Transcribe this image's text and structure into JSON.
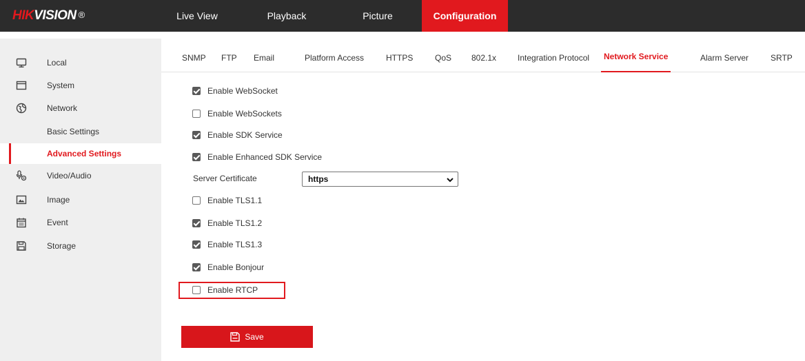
{
  "brand": {
    "logo_red": "HIK",
    "logo_white": "VISION",
    "reg_mark": "®"
  },
  "top_nav": [
    {
      "label": "Live View"
    },
    {
      "label": "Playback"
    },
    {
      "label": "Picture"
    },
    {
      "label": "Configuration",
      "active": true
    }
  ],
  "sidebar": {
    "items": [
      {
        "label": "Local",
        "icon": "monitor-icon"
      },
      {
        "label": "System",
        "icon": "window-icon"
      },
      {
        "label": "Network",
        "icon": "globe-icon"
      },
      {
        "label": "Basic Settings",
        "sub": true
      },
      {
        "label": "Advanced Settings",
        "sub": true,
        "active": true
      },
      {
        "label": "Video/Audio",
        "icon": "video-audio-icon"
      },
      {
        "label": "Image",
        "icon": "image-icon"
      },
      {
        "label": "Event",
        "icon": "calendar-icon"
      },
      {
        "label": "Storage",
        "icon": "floppy-icon"
      }
    ]
  },
  "tabs": [
    {
      "label": "SNMP"
    },
    {
      "label": "FTP"
    },
    {
      "label": "Email"
    },
    {
      "label": "Platform Access"
    },
    {
      "label": "HTTPS"
    },
    {
      "label": "QoS"
    },
    {
      "label": "802.1x"
    },
    {
      "label": "Integration Protocol"
    },
    {
      "label": "Network Service",
      "active": true
    },
    {
      "label": "Alarm Server"
    },
    {
      "label": "SRTP"
    }
  ],
  "options": [
    {
      "label": "Enable WebSocket",
      "checked": true
    },
    {
      "label": "Enable WebSockets",
      "checked": false
    },
    {
      "label": "Enable SDK Service",
      "checked": true
    },
    {
      "label": "Enable Enhanced SDK Service",
      "checked": true
    },
    {
      "label": "Enable TLS1.1",
      "checked": false
    },
    {
      "label": "Enable TLS1.2",
      "checked": true
    },
    {
      "label": "Enable TLS1.3",
      "checked": true
    },
    {
      "label": "Enable Bonjour",
      "checked": true
    },
    {
      "label": "Enable RTCP",
      "checked": false,
      "highlighted": true
    }
  ],
  "server_certificate": {
    "label": "Server Certificate",
    "value": "https"
  },
  "save_label": "Save",
  "colors": {
    "accent": "#e1191e",
    "topbar": "#2c2c2c",
    "sidebar": "#efefef"
  }
}
